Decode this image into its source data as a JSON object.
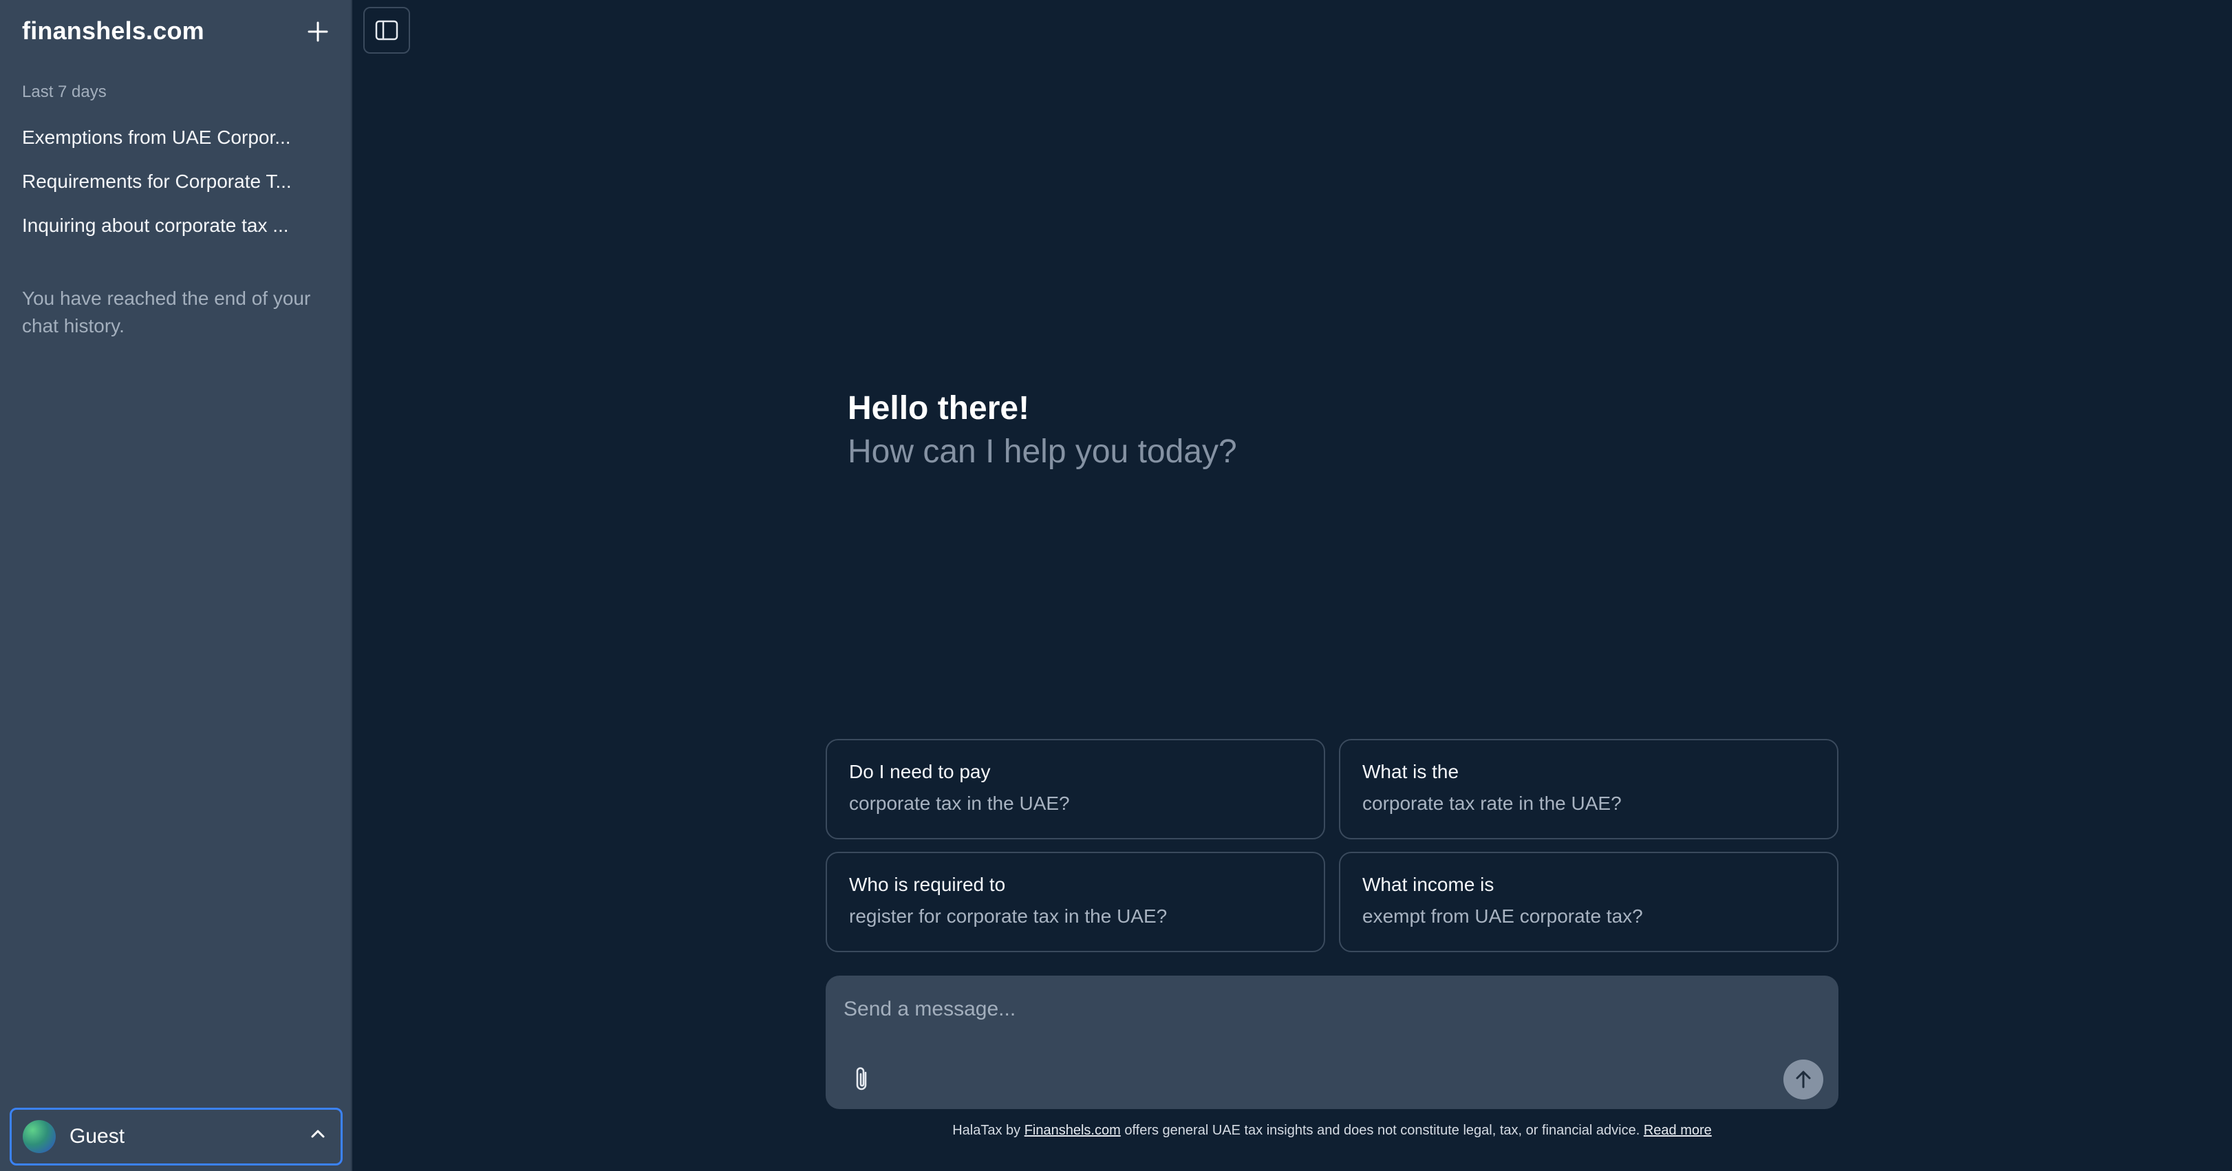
{
  "sidebar": {
    "brand": "finanshels.com",
    "new_chat_icon": "plus-icon",
    "section_label": "Last 7 days",
    "history": [
      {
        "title": "Exemptions from UAE Corpor..."
      },
      {
        "title": "Requirements for Corporate T..."
      },
      {
        "title": "Inquiring about corporate tax ..."
      }
    ],
    "end_note": "You have reached the end of your chat history.",
    "user": {
      "name": "Guest",
      "chevron_icon": "chevron-up-icon"
    }
  },
  "toolbar": {
    "toggle_icon": "sidebar-toggle-icon"
  },
  "greeting": {
    "title": "Hello there!",
    "subtitle": "How can I help you today?"
  },
  "suggestions": [
    {
      "line1": "Do I need to pay",
      "line2": "corporate tax in the UAE?"
    },
    {
      "line1": "What is the",
      "line2": "corporate tax rate in the UAE?"
    },
    {
      "line1": "Who is required to",
      "line2": "register for corporate tax in the UAE?"
    },
    {
      "line1": "What income is",
      "line2": "exempt from UAE corporate tax?"
    }
  ],
  "composer": {
    "placeholder": "Send a message...",
    "attach_icon": "paperclip-icon",
    "send_icon": "arrow-up-icon"
  },
  "disclaimer": {
    "prefix": "HalaTax by ",
    "link": "Finanshels.com",
    "middle": " offers general UAE tax insights and does not constitute legal, tax, or financial advice. ",
    "read_more": "Read more"
  },
  "colors": {
    "background": "#0f1f31",
    "sidebar": "#37475a",
    "accent": "#3b82f6"
  }
}
